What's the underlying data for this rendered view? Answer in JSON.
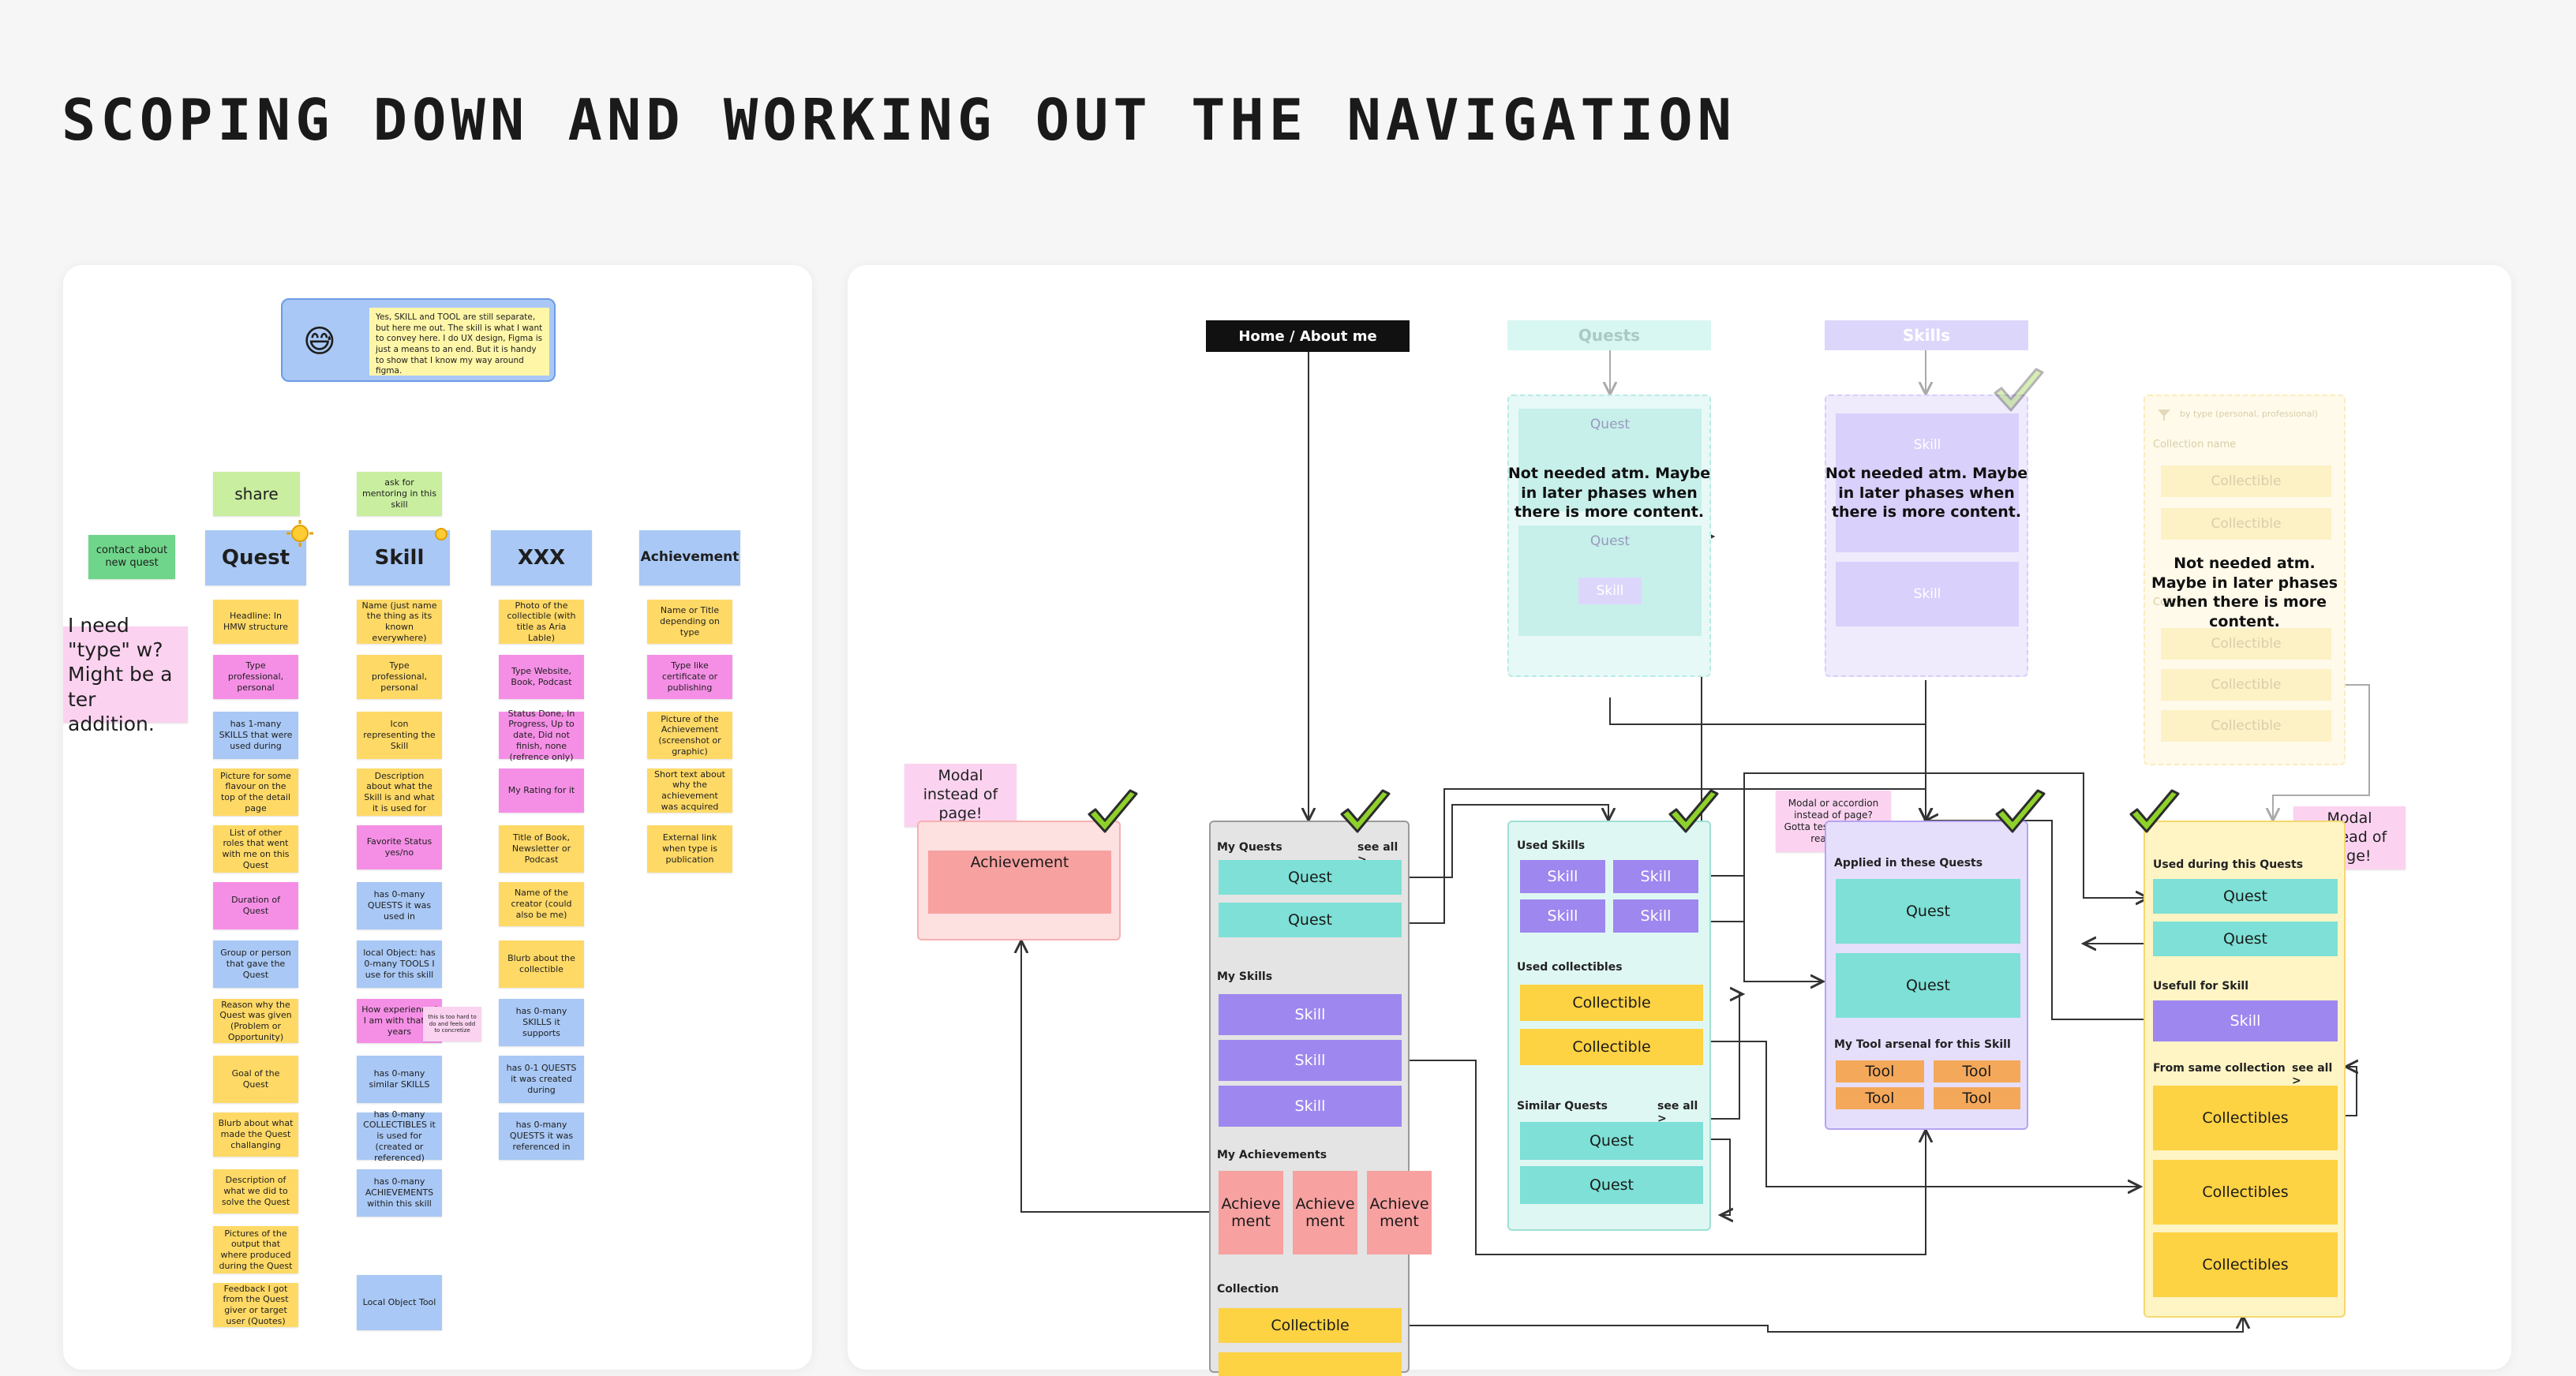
{
  "title": "SCOPING DOWN AND WORKING OUT THE NAVIGATION",
  "left": {
    "callout": {
      "emoji": "😅",
      "text": "Yes, SKILL and TOOL are still separate, but here me out. The skill is what I want to convey here. I do UX design, Figma is just a means to an end. But it is handy to show that I know my way around figma."
    },
    "share": "share",
    "ask_mentoring": "ask for mentoring in this skill",
    "contact": "contact about new quest",
    "need_type": "I need \"type\" w? Might be a ter addition.",
    "headers": [
      "Quest",
      "Skill",
      "XXX",
      "Achievement"
    ],
    "quest_col": [
      "Headline: In HMW structure",
      "Type professional, personal",
      "has 1-many SKILLS that were used during",
      "Picture for some flavour on the top of the detail page",
      "List of other roles that went with me on this Quest",
      "Duration of Quest",
      "Group or person that gave the Quest",
      "Reason why the Quest was given (Problem or Opportunity)",
      "Goal of the Quest",
      "Blurb about what made the Quest challanging",
      "Description of what we did to solve the Quest",
      "Pictures of the output that where produced during the Quest",
      "Feedback I got from the Quest giver or target user (Quotes)"
    ],
    "skill_col": [
      "Name (just name the thing as its known everywhere)",
      "Type professional, personal",
      "Icon representing the Skill",
      "Description about what the Skill is and what it is used for",
      "Favorite Status yes/no",
      "has 0-many QUESTS it was used in",
      "local Object: has 0-many TOOLS I use for this skill",
      "How experienced I am with that in years",
      "has 0-many similar SKILLS",
      "has 0-many COLLECTIBLES it is used for (created or referenced)",
      "has 0-many ACHIEVEMENTS within this skill",
      "Local Object Tool"
    ],
    "skill_note": "this is too hard to do and feels odd to concretize",
    "xxx_col": [
      "Photo of the collectible (with title as Aria Lable)",
      "Type Website, Book, Podcast",
      "Status Done, In Progress, Up to date, Did not finish, none (refrence only)",
      "My Rating for it",
      "Title of Book, Newsletter or Podcast",
      "Name of the creator (could also be me)",
      "Blurb about the collectible",
      "has 0-many SKILLS it supports",
      "has 0-1 QUESTS it was created during",
      "has 0-many QUESTS it was referenced in"
    ],
    "ach_col": [
      "Name or Title depending on type",
      "Type like certificate or publishing",
      "Picture of the Achievement (screenshot or graphic)",
      "Short text about why the achievement was acquired",
      "External link when type is publication"
    ]
  },
  "right": {
    "home": "Home / About me",
    "quests_title": "Quests",
    "skills_title": "Skills",
    "not_needed": "Not needed atm. Maybe in later phases when there is more content.",
    "quest_ghost": [
      "Quest",
      "Quest",
      "Skill"
    ],
    "skill_ghost": [
      "Skill",
      "Skill"
    ],
    "collection_ghost": {
      "filter": "by type (personal, professional)",
      "name": "Collection name",
      "items": [
        "Collectible",
        "Collectible",
        "Collectible",
        "Collectible",
        "Collectible"
      ],
      "trunc": "Collecti"
    },
    "modal_left": "Modal instead of page!",
    "modal_right": "Modal instead of page!",
    "modal_or_accordion": "Modal or accordion instead of page? Gotta test it out with real data.",
    "achievement_modal": "Achievement",
    "home_frame": {
      "my_quests": "My Quests",
      "see_all": "see all >",
      "quests": [
        "Quest",
        "Quest"
      ],
      "my_skills": "My Skills",
      "skills": [
        "Skill",
        "Skill",
        "Skill"
      ],
      "my_achievements": "My Achievements",
      "achievements": [
        "Achieve ment",
        "Achieve ment",
        "Achieve ment"
      ],
      "collection": "Collection",
      "collectibles": [
        "Collectible"
      ]
    },
    "quest_detail": {
      "used_skills": "Used Skills",
      "skills": [
        "Skill",
        "Skill",
        "Skill",
        "Skill"
      ],
      "used_collectibles": "Used collectibles",
      "collectibles": [
        "Collectible",
        "Collectible"
      ],
      "similar_quests": "Similar Quests",
      "see_all": "see all >",
      "quests": [
        "Quest",
        "Quest"
      ]
    },
    "skill_detail": {
      "applied": "Applied in these Quests",
      "quests": [
        "Quest",
        "Quest"
      ],
      "tool_arsenal": "My Tool arsenal for this Skill",
      "tools": [
        "Tool",
        "Tool",
        "Tool",
        "Tool"
      ]
    },
    "collectible_detail": {
      "used_during": "Used during this Quests",
      "quests": [
        "Quest",
        "Quest"
      ],
      "usefull_for": "Usefull for Skill",
      "skill": "Skill",
      "from_same": "From same collection",
      "see_all": "see all >",
      "collectibles": [
        "Collectibles",
        "Collectibles",
        "Collectibles"
      ]
    },
    "colors": {
      "teal": "#7ee0d6",
      "purple": "#9e87ef",
      "salmon": "#f7a1a1",
      "yellow": "#fdd243",
      "orange": "#f4a85a",
      "check": "#8ed12a"
    }
  }
}
